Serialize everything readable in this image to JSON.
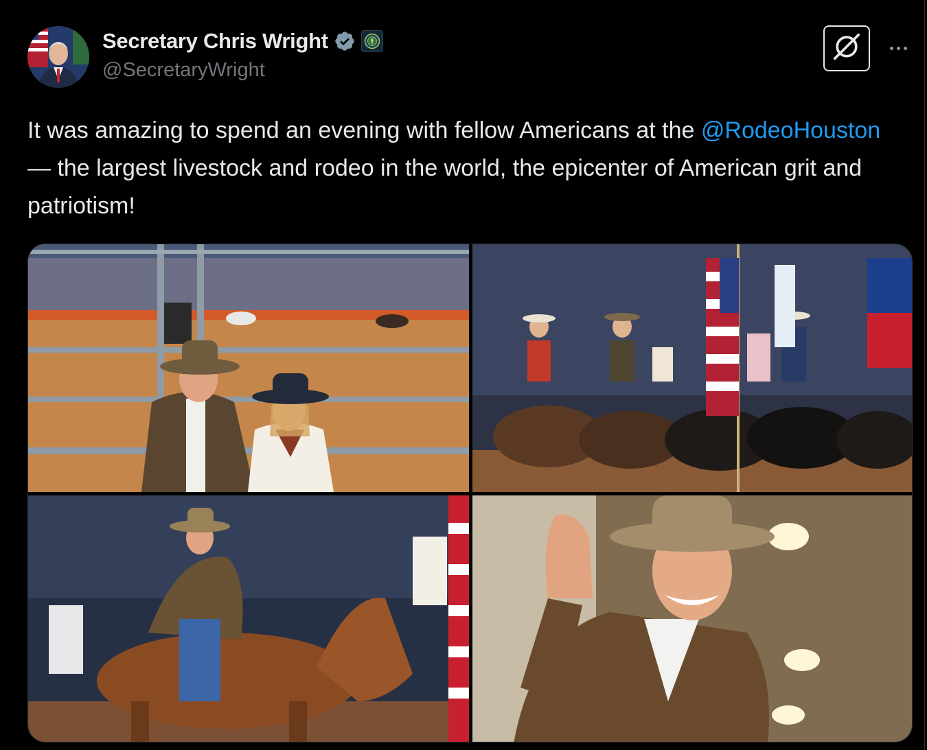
{
  "author": {
    "display_name": "Secretary Chris Wright",
    "handle": "@SecretaryWright"
  },
  "tweet": {
    "text_part1": "It was amazing to spend an evening with fellow Americans at the ",
    "mention": "@RodeoHouston",
    "text_part2": " — the largest livestock and rodeo in the world, the epicenter of American grit and patriotism!"
  },
  "icons": {
    "verified": "verified-badge-icon",
    "affiliate": "department-of-energy-seal-icon",
    "grok": "grok-icon",
    "more": "more-options-icon"
  },
  "colors": {
    "background": "#000000",
    "text": "#e7e9ea",
    "secondary_text": "#71767b",
    "link": "#1d9bf0",
    "verified_badge": "#829aab"
  },
  "media": {
    "photos": [
      {
        "alt_subject": "couple in cowboy hats at rodeo arena fence"
      },
      {
        "alt_subject": "riders on horses carrying American and Texas flags"
      },
      {
        "alt_subject": "man in cowboy hat riding a horse in arena"
      },
      {
        "alt_subject": "man in cowboy hat smiling and waving"
      }
    ]
  }
}
